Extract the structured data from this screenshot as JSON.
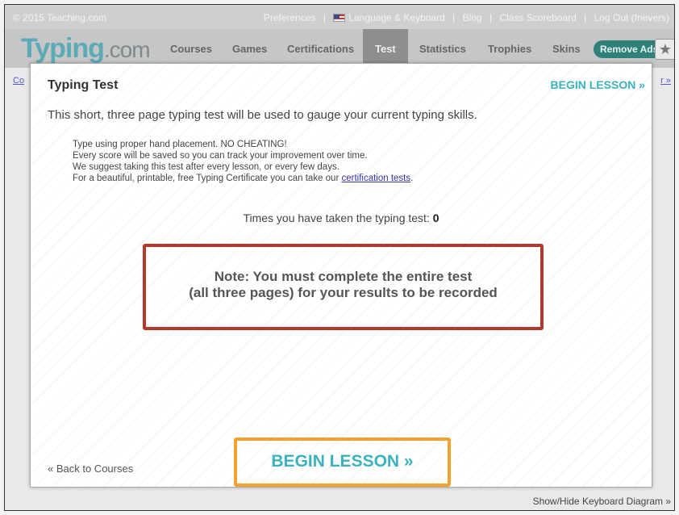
{
  "topbar": {
    "copyright": "© 2015 Teaching.com",
    "links": [
      "Preferences",
      "Language & Keyboard",
      "Blog",
      "Class Scoreboard",
      "Log Out (fnevers)"
    ]
  },
  "nav": {
    "logo_main": "Typing",
    "logo_suffix": ".com",
    "items": [
      "Courses",
      "Games",
      "Certifications",
      "Test",
      "Statistics",
      "Trophies",
      "Skins"
    ],
    "active": "Test",
    "remove_ads": "Remove Ads",
    "star_icon": "star-icon"
  },
  "background": {
    "crumb_left": "Co",
    "crumb_right": "r »",
    "keyboard_toggle": "Show/Hide Keyboard Diagram »"
  },
  "modal": {
    "title": "Typing Test",
    "begin_top": "BEGIN LESSON »",
    "intro": "This short, three page typing test will be used to gauge your current typing skills.",
    "rules": [
      "Type using proper hand placement. NO CHEATING!",
      "Every score will be saved so you can track your improvement over time.",
      "We suggest taking this test after every lesson, or every few days."
    ],
    "cert_prefix": "For a beautiful, printable, free Typing Certificate you can take our ",
    "cert_link": "certification tests",
    "cert_suffix": ".",
    "times_label": "Times you have taken the typing test: ",
    "times_value": "0",
    "note_line1": "Note: You must complete the entire test",
    "note_line2": "(all three pages) for your results to be recorded",
    "back": "« Back to Courses",
    "begin_bottom": "BEGIN LESSON »"
  },
  "colors": {
    "accent": "#3bb2bd",
    "note_border": "#b03a2b",
    "button_border": "#f0a230"
  }
}
